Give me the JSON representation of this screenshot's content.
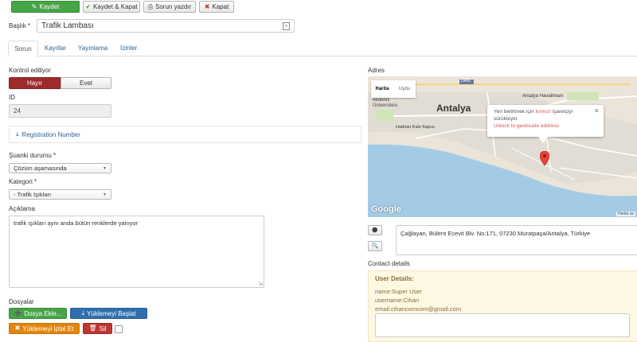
{
  "toolbar": {
    "save": "Kaydet",
    "save_close": "Kaydet & Kapat",
    "print_issue": "Sorun yazdır",
    "close": "Kapat"
  },
  "title": {
    "label": "Başlık",
    "required": "*",
    "value": "Trafik Lambası"
  },
  "tabs": [
    "Sorun",
    "Kayıtlar",
    "Yayınlama",
    "İzinler"
  ],
  "form": {
    "moderated_label": "Kontrol ediliyor",
    "no": "Hayır",
    "yes": "Evet",
    "id_label": "ID",
    "id_value": "24",
    "registration_number": "Registration Number",
    "status_label": "Şuanki durumu",
    "status_required": "*",
    "status_value": "Çözüm aşamasında",
    "category_label": "Kategori",
    "category_required": "*",
    "category_value": "- Trafik Işıkları",
    "description_label": "Açıklama",
    "description_value": "trafik ışıkları aynı anda bütün renklerde yanıyor",
    "files_label": "Dosyalar",
    "add_file": "Dosya Ekle...",
    "start_upload": "Yüklemeyi Başlat",
    "cancel_upload": "Yüklemeyi İptal Et",
    "delete": "Sil"
  },
  "address": {
    "label": "Adres",
    "map_type_map": "Harita",
    "map_type_satellite": "Uydu",
    "city_label": "Antalya",
    "airport_label": "Antalya Havalimanı",
    "university_label": "Akdeniz Üniversitesi",
    "hadrian_label": "Hadrian Kale Kapısı",
    "road_label": "D400",
    "popup_line1_a": "Yeri belirtmek için ",
    "popup_line1_red": "kırmızı",
    "popup_line1_b": " işaretçiyi",
    "popup_line2": "sürükleyin.",
    "popup_link": "Unlock to geolocate address",
    "google": "Google",
    "map_data": "Harita ve",
    "value": "Çağlayan, Bülent Ecevit Blv. No:171, 07230 Muratpaşa/Antalya, Türkiye"
  },
  "contact": {
    "label": "Contact details",
    "user_details": "User Details:",
    "name": "name:Super User",
    "username": "username:Cihan",
    "email": "email:cihancomcom@gmail.com"
  }
}
